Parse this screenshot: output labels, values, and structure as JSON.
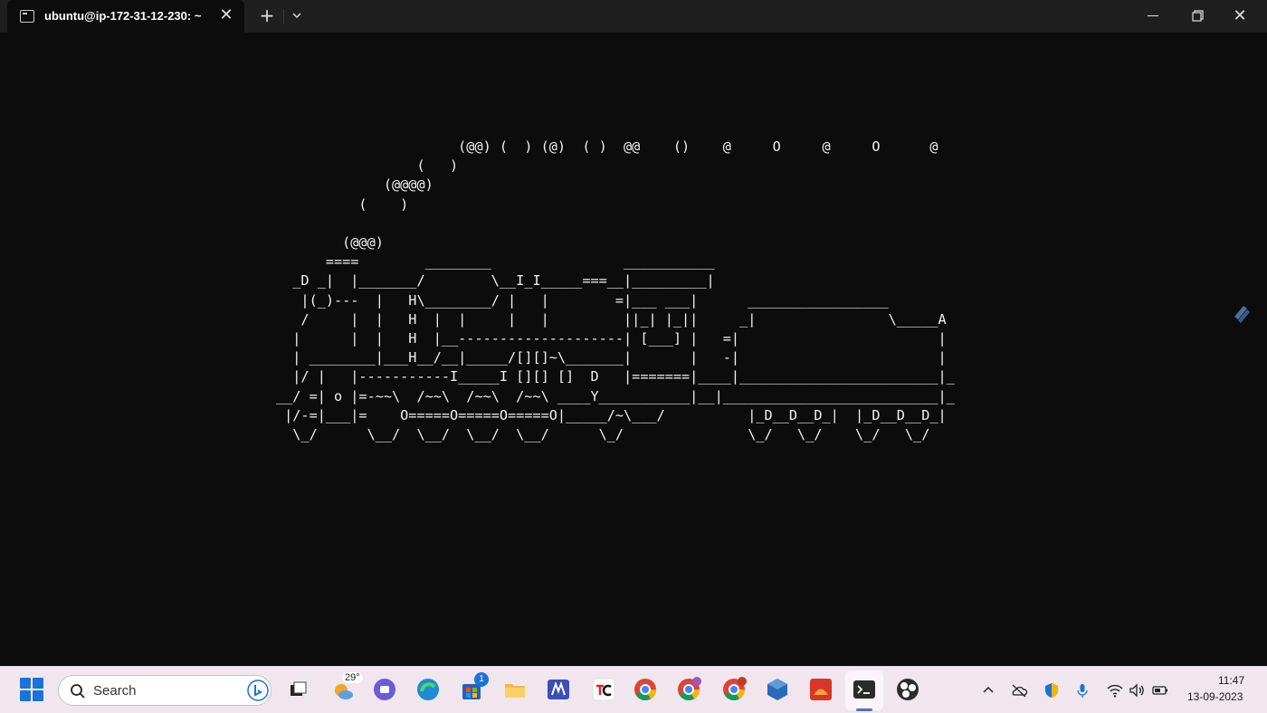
{
  "window": {
    "tab_title": "ubuntu@ip-172-31-12-230: ~",
    "tab_close": "✕",
    "new_tab": "+",
    "close": "✕"
  },
  "terminal": {
    "ascii_art": "                      (@@) (  ) (@)  ( )  @@    ()    @     O     @     O      @\n                 (   )\n             (@@@@)\n          (    )\n\n        (@@@)\n      ====        ________                ___________\n  _D _|  |_______/        \\__I_I_____===__|_________|\n   |(_)---  |   H\\________/ |   |        =|___ ___|      _________________\n   /     |  |   H  |  |     |   |         ||_| |_||     _|                \\_____A\n  |      |  |   H  |__--------------------| [___] |   =|                        |\n  | ________|___H__/__|_____/[][]~\\_______|       |   -|                        |\n  |/ |   |-----------I_____I [][] []  D   |=======|____|________________________|_\n__/ =| o |=-~~\\  /~~\\  /~~\\  /~~\\ ____Y___________|__|__________________________|_\n |/-=|___|=    O=====O=====O=====O|_____/~\\___/          |_D__D__D_|  |_D__D__D_|\n  \\_/      \\__/  \\__/  \\__/  \\__/      \\_/               \\_/   \\_/    \\_/   \\_/"
  },
  "taskbar": {
    "search_placeholder": "Search",
    "weather_temp": "29°",
    "store_badge": "1",
    "clock_time": "11:47",
    "clock_date": "13-09-2023",
    "colors": {
      "accent": "#1a73d9",
      "taskbar_bg": "#f1e6ee",
      "terminal_bg": "#0c0c0c"
    }
  }
}
